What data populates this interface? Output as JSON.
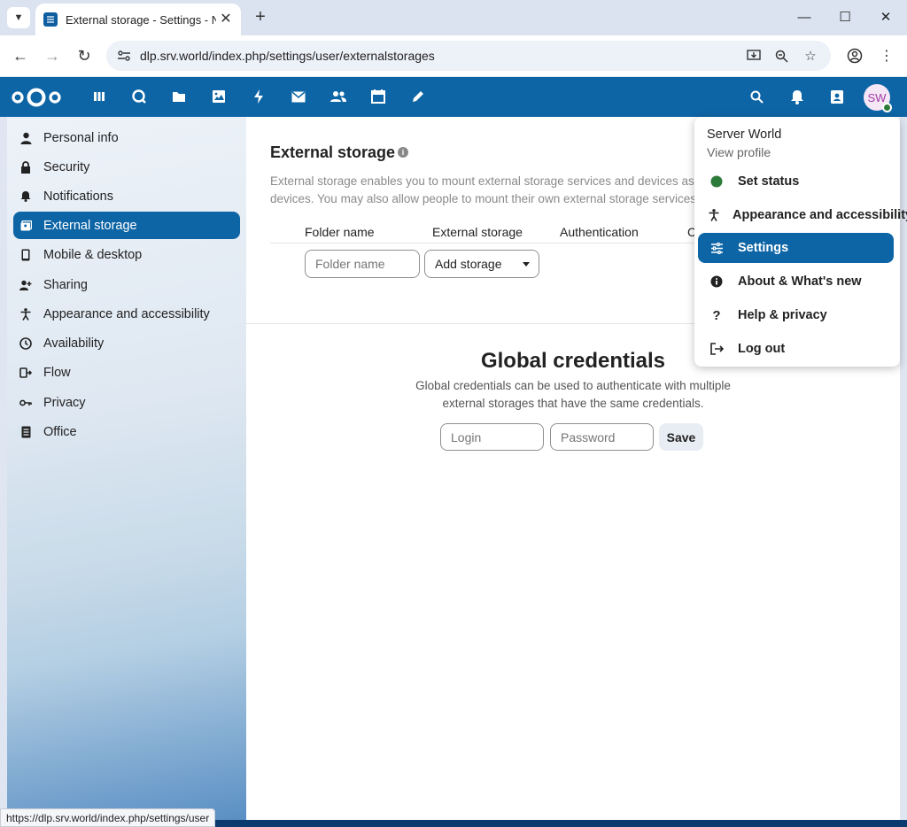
{
  "browser": {
    "tab_title": "External storage - Settings - Nextcloud",
    "url": "dlp.srv.world/index.php/settings/user/externalstorages",
    "status_url": "https://dlp.srv.world/index.php/settings/user"
  },
  "header": {
    "apps": [
      "dashboard",
      "search",
      "files",
      "photos",
      "activity",
      "mail",
      "contacts",
      "calendar",
      "notes"
    ],
    "avatar_initials": "SW"
  },
  "sidebar": {
    "items": [
      {
        "label": "Personal info",
        "icon": "person-icon"
      },
      {
        "label": "Security",
        "icon": "lock-icon"
      },
      {
        "label": "Notifications",
        "icon": "bell-icon"
      },
      {
        "label": "External storage",
        "icon": "external-storage-icon",
        "active": true
      },
      {
        "label": "Mobile & desktop",
        "icon": "phone-icon"
      },
      {
        "label": "Sharing",
        "icon": "share-icon"
      },
      {
        "label": "Appearance and accessibility",
        "icon": "accessibility-icon"
      },
      {
        "label": "Availability",
        "icon": "clock-icon"
      },
      {
        "label": "Flow",
        "icon": "flow-icon"
      },
      {
        "label": "Privacy",
        "icon": "key-icon"
      },
      {
        "label": "Office",
        "icon": "document-icon"
      }
    ]
  },
  "main": {
    "external_storage": {
      "title": "External storage",
      "description_line1": "External storage enables you to mount external storage services and devices as s",
      "description_line2": "devices. You may also allow people to mount their own external storage services.",
      "columns": [
        "Folder name",
        "External storage",
        "Authentication",
        "C"
      ],
      "folder_placeholder": "Folder name",
      "add_storage": "Add storage"
    },
    "global_credentials": {
      "title": "Global credentials",
      "description_line1": "Global credentials can be used to authenticate with multiple",
      "description_line2": "external storages that have the same credentials.",
      "login_placeholder": "Login",
      "password_placeholder": "Password",
      "save_label": "Save"
    }
  },
  "user_menu": {
    "name": "Server World",
    "profile_link": "View profile",
    "items": [
      {
        "label": "Set status",
        "icon": "status-dot-icon"
      },
      {
        "label": "Appearance and accessibility",
        "icon": "accessibility-icon"
      },
      {
        "label": "Settings",
        "icon": "settings-sliders-icon",
        "active": true
      },
      {
        "label": "About & What's new",
        "icon": "info-icon"
      },
      {
        "label": "Help & privacy",
        "icon": "help-icon"
      },
      {
        "label": "Log out",
        "icon": "logout-icon"
      }
    ]
  },
  "colors": {
    "brand": "#0e65a6",
    "status_online": "#2d7b3a"
  }
}
